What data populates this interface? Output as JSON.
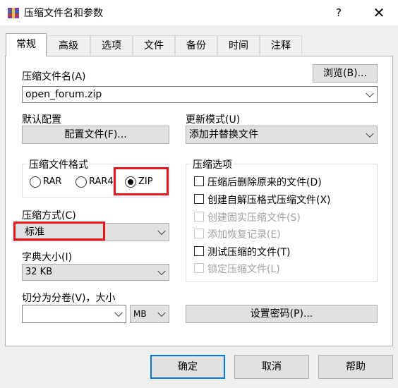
{
  "window": {
    "title": "压缩文件名和参数",
    "help": "?",
    "close": "✕"
  },
  "tabs": [
    "常规",
    "高级",
    "选项",
    "文件",
    "备份",
    "时间",
    "注释"
  ],
  "archive_name": {
    "label": "压缩文件名(A)",
    "browse_label": "浏览(B)...",
    "value": "open_forum.zip"
  },
  "profile": {
    "label": "默认配置",
    "button_label": "配置文件(F)..."
  },
  "update_mode": {
    "label": "更新模式(U)",
    "value": "添加并替换文件"
  },
  "format": {
    "title": "压缩文件格式",
    "options": [
      "RAR",
      "RAR4",
      "ZIP"
    ],
    "selected": "ZIP"
  },
  "method": {
    "label": "压缩方式(C)",
    "value": "标准"
  },
  "dictionary": {
    "label": "字典大小(I)",
    "value": "32 KB"
  },
  "split": {
    "label": "切分为分卷(V)，大小",
    "value": "",
    "unit": "MB"
  },
  "options": {
    "title": "压缩选项",
    "items": [
      {
        "label": "压缩后删除原来的文件(D)",
        "enabled": true,
        "checked": false
      },
      {
        "label": "创建自解压格式压缩文件(X)",
        "enabled": true,
        "checked": false
      },
      {
        "label": "创建固实压缩文件(S)",
        "enabled": false,
        "checked": false
      },
      {
        "label": "添加恢复记录(E)",
        "enabled": false,
        "checked": false
      },
      {
        "label": "测试压缩的文件(T)",
        "enabled": true,
        "checked": false
      },
      {
        "label": "锁定压缩文件(L)",
        "enabled": false,
        "checked": false
      }
    ]
  },
  "password_button": "设置密码(P)...",
  "footer": {
    "ok": "确定",
    "cancel": "取消",
    "help": "帮助"
  },
  "colors": {
    "accent": "#0078d7",
    "highlight": "#e8141c"
  }
}
